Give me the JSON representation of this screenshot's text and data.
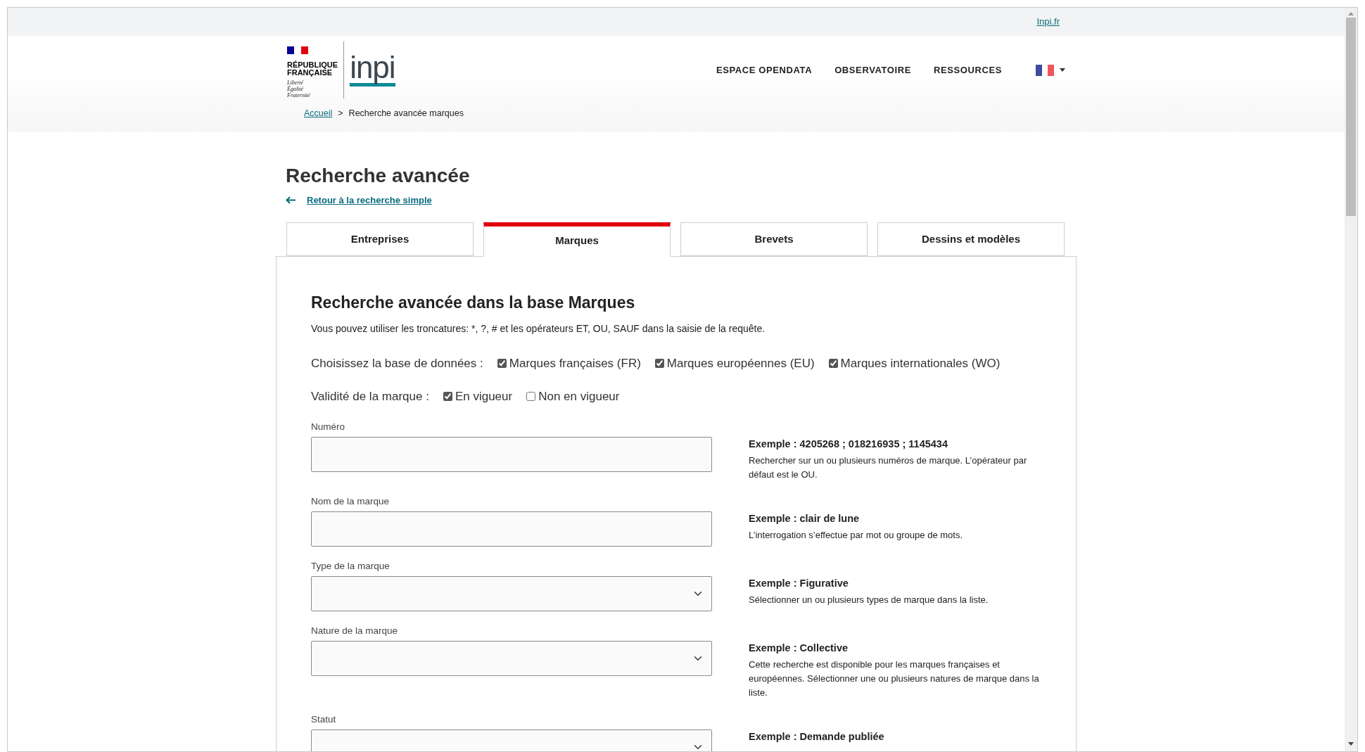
{
  "top_bar": {
    "link": "Inpi.fr"
  },
  "header": {
    "logo": {
      "republic": [
        "RÉPUBLIQUE",
        "FRANÇAISE"
      ],
      "motto": [
        "Liberté",
        "Égalité",
        "Fraternité"
      ],
      "brand": "inpi"
    },
    "nav": [
      "ESPACE OPENDATA",
      "OBSERVATOIRE",
      "RESSOURCES"
    ]
  },
  "breadcrumb": {
    "items": [
      {
        "label": "Accueil",
        "link": true
      },
      {
        "label": "Recherche avancée marques",
        "link": false
      }
    ],
    "separator": ">"
  },
  "page_title": "Recherche avancée",
  "back_link": "Retour à la recherche simple",
  "tabs": [
    {
      "label": "Entreprises",
      "selected": false
    },
    {
      "label": "Marques",
      "selected": true
    },
    {
      "label": "Brevets",
      "selected": false
    },
    {
      "label": "Dessins et modèles",
      "selected": false
    }
  ],
  "section": {
    "title": "Recherche avancée dans la base Marques",
    "hint": "Vous pouvez utiliser les troncatures: *, ?, # et les opérateurs ET, OU, SAUF dans la saisie de la requête.",
    "option_groups": [
      {
        "label": "Choisissez la base de données :",
        "options": [
          {
            "label": "Marques françaises (FR)",
            "checked": true
          },
          {
            "label": "Marques européennes (EU)",
            "checked": true
          },
          {
            "label": "Marques internationales (WO)",
            "checked": true
          }
        ]
      },
      {
        "label": "Validité de la marque :",
        "options": [
          {
            "label": "En vigueur",
            "checked": true
          },
          {
            "label": "Non en vigueur",
            "checked": false
          }
        ]
      }
    ],
    "fields": [
      {
        "label": "Numéro",
        "kind": "text",
        "example": "Exemple : 4205268 ; 018216935 ; 1145434",
        "help": "Rechercher sur un ou plusieurs numéros de marque. L’opérateur par défaut est le OU."
      },
      {
        "label": "Nom de la marque",
        "kind": "text",
        "example": "Exemple : clair de lune",
        "help": "L’interrogation s’effectue par mot ou groupe de mots."
      },
      {
        "label": "Type de la marque",
        "kind": "select",
        "example": "Exemple : Figurative",
        "help": "Sélectionner un ou plusieurs types de marque dans la liste."
      },
      {
        "label": "Nature de la marque",
        "kind": "select",
        "example": "Exemple : Collective",
        "help": "Cette recherche est disponible pour les marques françaises et européennes. Sélectionner une ou plusieurs natures de marque dans la liste."
      },
      {
        "label": "Statut",
        "kind": "select",
        "example": "Exemple : Demande publiée"
      }
    ]
  }
}
